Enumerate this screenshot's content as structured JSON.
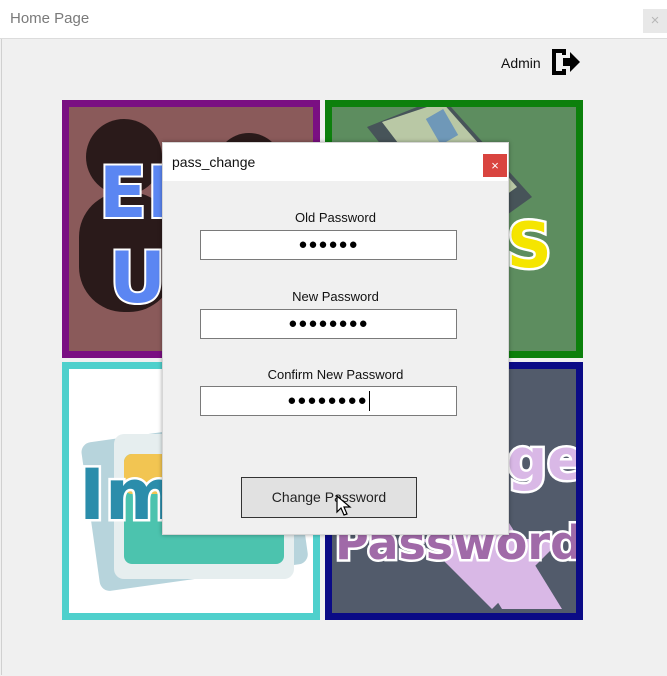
{
  "window": {
    "title": "Home Page",
    "close_glyph": "×"
  },
  "header": {
    "user_label": "Admin",
    "logout_icon": "logout-icon"
  },
  "tiles": {
    "edit_users": {
      "line1": "ED",
      "line2": "US"
    },
    "images_top": {
      "partial": "S"
    },
    "images": {
      "partial": "Im"
    },
    "change_password": {
      "line1": "ge",
      "line2": "Password"
    }
  },
  "dialog": {
    "title": "pass_change",
    "close_glyph": "×",
    "old_label": "Old Password",
    "old_value": "●●●●●●",
    "new_label": "New Password",
    "new_value": "●●●●●●●●",
    "confirm_label": "Confirm New Password",
    "confirm_value": "●●●●●●●●",
    "submit_label": "Change Password"
  },
  "colors": {
    "tile_edit_border": "#7a0f82",
    "tile_img_border": "#0c800c",
    "tile_images_border": "#4fd0cc",
    "tile_pass_border": "#0b0b86",
    "dialog_close": "#d9443f"
  }
}
